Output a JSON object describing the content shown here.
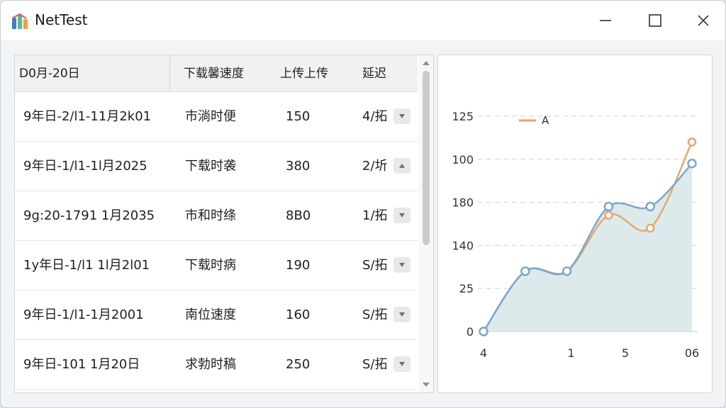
{
  "app": {
    "title": "NetTest"
  },
  "table": {
    "headers": [
      "D0月-20日",
      "下载馨速度",
      "上传上传",
      "延迟"
    ],
    "rows": [
      {
        "date": "9年日-2/l1-11月2k01",
        "speed": "市淌时便",
        "upload": "150",
        "latency": "4/拓",
        "button": "down"
      },
      {
        "date": "9年日-1/l1-1l月2025",
        "speed": "下载时袭",
        "upload": "380",
        "latency": "2/圻",
        "button": "up"
      },
      {
        "date": "9g:20-1791 1月2035",
        "speed": "市和时绦",
        "upload": "8B0",
        "latency": "1/拓",
        "button": "down"
      },
      {
        "date": "1y年日-1/l1 1l月2l01",
        "speed": "下载时病",
        "upload": "190",
        "latency": "S/拓",
        "button": "down"
      },
      {
        "date": "9年日-1/l1-1月2001",
        "speed": "南位速度",
        "upload": "160",
        "latency": "S/拓",
        "button": "down"
      },
      {
        "date": "9年日-101 1月20日",
        "speed": "求勃时稿",
        "upload": "250",
        "latency": "S/拓",
        "button": "down"
      }
    ]
  },
  "chart_data": {
    "type": "line",
    "title": "",
    "xlabel": "",
    "ylabel": "",
    "y_tick_labels": [
      "0",
      "25",
      "140",
      "180",
      "100",
      "125"
    ],
    "x_tick_labels": [
      "4",
      "1",
      "5",
      "06"
    ],
    "legend": {
      "label": "A",
      "position": "top-left"
    },
    "grid": true,
    "series": [
      {
        "name": "A",
        "color": "#e8a66f",
        "area": false,
        "points": [
          [
            0,
            0
          ],
          [
            1,
            1.4
          ],
          [
            2,
            1.4
          ],
          [
            3,
            2.7
          ],
          [
            4,
            2.4
          ],
          [
            5,
            4.4
          ]
        ]
      },
      {
        "color": "#7aa6cf",
        "area": true,
        "area_color": "#d8e8ea",
        "points": [
          [
            0,
            0
          ],
          [
            1,
            1.4
          ],
          [
            2,
            1.4
          ],
          [
            3,
            2.9
          ],
          [
            4,
            2.9
          ],
          [
            5,
            3.9
          ]
        ]
      }
    ]
  },
  "colors": {
    "accent": "#7aa6cf",
    "orange": "#e8a66f",
    "area": "#d8e8ea"
  },
  "icons": {
    "app": "nettest-logo",
    "minimize": "minimize-icon",
    "maximize": "maximize-icon",
    "close": "close-icon"
  }
}
